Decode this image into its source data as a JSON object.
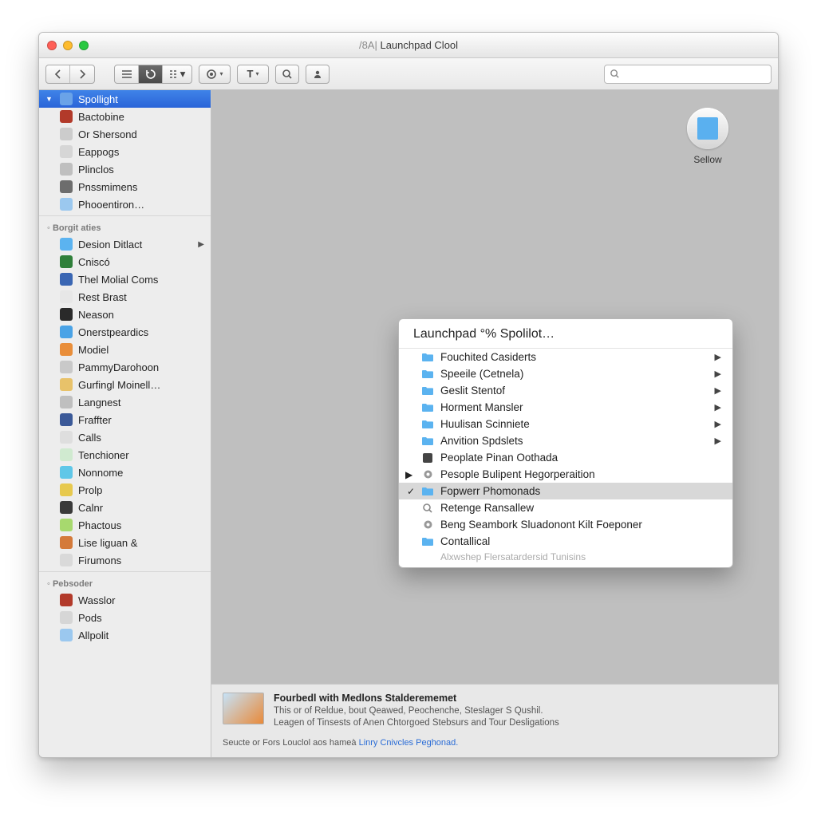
{
  "window": {
    "title_prefix": "/8A|",
    "title": "Launchpad Clool"
  },
  "search": {
    "placeholder": ""
  },
  "sidebar": {
    "groups": [
      {
        "header": "",
        "items": [
          {
            "label": "Spollight",
            "selected": true,
            "disclosure": "▼",
            "iconColor": "#6aa3e8"
          },
          {
            "label": "Bactobine",
            "iconColor": "#b23a2a"
          },
          {
            "label": "Or Shersond",
            "iconColor": "#cccccc"
          },
          {
            "label": "Eappogs",
            "iconColor": "#d6d6d6"
          },
          {
            "label": "Plinclos",
            "iconColor": "#bfbfbf"
          },
          {
            "label": "Pnssmimens",
            "iconColor": "#6d6d6d"
          },
          {
            "label": "Phooentiron…",
            "iconColor": "#9bc8ef"
          }
        ]
      },
      {
        "header": "Borgit aties",
        "items": [
          {
            "label": "Desion Ditlact",
            "iconColor": "#5bb3f0",
            "hasSubmenu": true
          },
          {
            "label": "Cniscó",
            "iconColor": "#2f7f3a"
          },
          {
            "label": "Thel Molial Coms",
            "iconColor": "#3a66b3"
          },
          {
            "label": "Rest Brast",
            "iconColor": "#e7e7e7"
          },
          {
            "label": "Neason",
            "iconColor": "#2a2a2a"
          },
          {
            "label": "Onerstpeardics",
            "iconColor": "#4aa3e6"
          },
          {
            "label": "Modiel",
            "iconColor": "#e98e3a"
          },
          {
            "label": "PammyDarohoon",
            "iconColor": "#c9c9c9"
          },
          {
            "label": "Gurfingl Moinell…",
            "iconColor": "#e8c26a"
          },
          {
            "label": "Langnest",
            "iconColor": "#bfbfbf"
          },
          {
            "label": "Fraffter",
            "iconColor": "#3b5998"
          },
          {
            "label": "Calls",
            "iconColor": "#dedede"
          },
          {
            "label": "Tenchioner",
            "iconColor": "#d0ead0"
          },
          {
            "label": "Nonnome",
            "iconColor": "#5fc7e8"
          },
          {
            "label": "Prolp",
            "iconColor": "#e7c94e"
          },
          {
            "label": "Calnr",
            "iconColor": "#3a3a3a"
          },
          {
            "label": "Phactous",
            "iconColor": "#a7d96e"
          },
          {
            "label": "Lise liguan &",
            "iconColor": "#d47a3a"
          },
          {
            "label": "Firumons",
            "iconColor": "#d9d9d9"
          }
        ]
      },
      {
        "header": "Pebsoder",
        "items": [
          {
            "label": "Wasslor",
            "iconColor": "#b23a2a"
          },
          {
            "label": "Pods",
            "iconColor": "#d6d6d6"
          },
          {
            "label": "Allpolit",
            "iconColor": "#9bc8ef"
          }
        ]
      }
    ]
  },
  "content": {
    "app_icon_label": "Sellow"
  },
  "popup": {
    "title": "Launchpad °% Spolilot…",
    "items": [
      {
        "label": "Fouchited Casiderts",
        "type": "folder",
        "arrow": true
      },
      {
        "label": "Speeile (Cetnela)",
        "type": "folder",
        "arrow": true
      },
      {
        "label": "Geslit Stentof",
        "type": "folder",
        "arrow": true
      },
      {
        "label": "Horment Mansler",
        "type": "folder",
        "arrow": true
      },
      {
        "label": "Huulisan Scinniete",
        "type": "folder",
        "arrow": true
      },
      {
        "label": "Anvition Spdslets",
        "type": "folder",
        "arrow": true
      },
      {
        "label": "Peoplate Pinan Oothada",
        "type": "app"
      },
      {
        "label": "Pesople Bulipent Hegorperaition",
        "type": "gear",
        "disclosure": "▶"
      },
      {
        "label": "Fopwerr Phomonads",
        "type": "folder",
        "checked": true,
        "selected": true
      },
      {
        "label": "Retenge Ransallew",
        "type": "search"
      },
      {
        "label": "Beng Seambork Sluadonont Kilt Foeponer",
        "type": "gear"
      },
      {
        "label": "Contallical",
        "type": "folder"
      },
      {
        "label": "Alxwshep Flersatardersid Tunisins",
        "type": "faded"
      }
    ]
  },
  "footer": {
    "title": "Fourbedl with Medlons Stalderememet",
    "line1": "This or of Reldue, bout Qeawed, Peochenche, Steslager S Qushil.",
    "line2": "Leagen of Tinsests of Anen Chtorgoed Stebsurs and Tour Desligations",
    "line3_prefix": "Seucte or Fors Louclol aos hameà ",
    "line3_link": "Linry Cnivcles Peghonad."
  }
}
